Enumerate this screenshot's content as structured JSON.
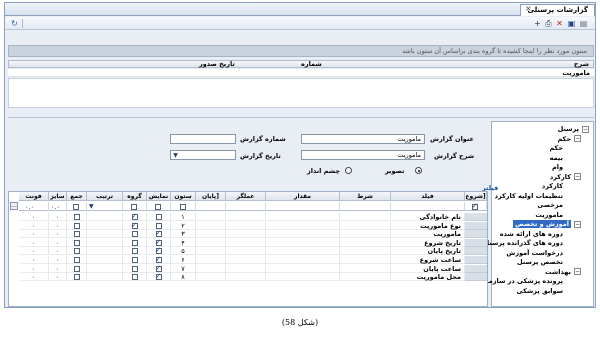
{
  "tab": {
    "title": "گزارشات پرسنلی"
  },
  "toolbar": {
    "icons": [
      "refresh-icon",
      "add-icon",
      "print-icon",
      "print-preview-icon",
      "delete-icon",
      "save-icon",
      "new-icon"
    ]
  },
  "groupby": {
    "hint": "ستون مورد نظر را اینجا کشیده تا گروه بندی براساس آن ستون باشد"
  },
  "report_list": {
    "columns": {
      "desc": "شرح",
      "number": "شماره",
      "date": "تاریخ صدور"
    },
    "rows": [
      {
        "desc": "ماموریت",
        "number": "",
        "date": ""
      }
    ]
  },
  "tree": {
    "items": [
      {
        "label": "پرسنل",
        "level": 0
      },
      {
        "label": "حکم",
        "level": 1
      },
      {
        "label": "حکم",
        "level": 2
      },
      {
        "label": "بیمه",
        "level": 2
      },
      {
        "label": "وام",
        "level": 2
      },
      {
        "label": "کارکرد",
        "level": 1
      },
      {
        "label": "کارکرد",
        "level": 2
      },
      {
        "label": "تنظیمات اولیه کارکرد",
        "level": 2
      },
      {
        "label": "مرخصی",
        "level": 2
      },
      {
        "label": "ماموریت",
        "level": 2
      },
      {
        "label": "آموزش و تخصص",
        "level": 1,
        "selected": true
      },
      {
        "label": "دوره های ارائه شده",
        "level": 2
      },
      {
        "label": "دوره های گذرانده پرسنل",
        "level": 2
      },
      {
        "label": "درخواست آموزش",
        "level": 2
      },
      {
        "label": "تخصص پرسنل",
        "level": 2
      },
      {
        "label": "بهداشت",
        "level": 1
      },
      {
        "label": "پرونده پزشکی در سازمان",
        "level": 2
      },
      {
        "label": "سوابق پزشکی",
        "level": 2
      }
    ]
  },
  "form": {
    "title_label": "عنوان گزارش",
    "title_value": "ماموریت",
    "desc_label": "شرح گزارش",
    "desc_value": "ماموریت",
    "number_label": "شماره گزارش",
    "number_value": "",
    "date_label": "تاریخ گزارش",
    "date_value": "",
    "radio_image": "تصویر",
    "radio_landscape": "چشم انداز",
    "filter_label": "فیلتر"
  },
  "grid": {
    "headers": [
      "شروع]",
      "فیلد",
      "شرط",
      "مقدار",
      "عملگر",
      "پایان]",
      "ستون",
      "نمایش",
      "گروه",
      "ترتیب",
      "جمع",
      "سایز",
      "فونت"
    ],
    "filter_size": "۰.۰",
    "filter_font": "۰.۰",
    "rows": [
      {
        "field": "نام خانوادگی",
        "col": "۱",
        "show": false,
        "group": true,
        "size": "۰",
        "font": "۰"
      },
      {
        "field": "نوع ماموریت",
        "col": "۲",
        "show": false,
        "group": true,
        "size": "۰",
        "font": "۰"
      },
      {
        "field": "ماموریت",
        "col": "۳",
        "show": true,
        "group": false,
        "size": "۰",
        "font": "۰"
      },
      {
        "field": "تاریخ شروع",
        "col": "۴",
        "show": true,
        "group": false,
        "size": "۰",
        "font": "۰"
      },
      {
        "field": "تاریخ پایان",
        "col": "۵",
        "show": true,
        "group": false,
        "size": "۰",
        "font": "۰"
      },
      {
        "field": "ساعت شروع",
        "col": "۶",
        "show": true,
        "group": false,
        "size": "۰",
        "font": "۰"
      },
      {
        "field": "ساعت پایان",
        "col": "۷",
        "show": true,
        "group": false,
        "size": "۰",
        "font": "۰"
      },
      {
        "field": "محل ماموریت",
        "col": "۸",
        "show": true,
        "group": false,
        "size": "۰",
        "font": "۰"
      }
    ]
  },
  "caption": "(شکل 58)"
}
